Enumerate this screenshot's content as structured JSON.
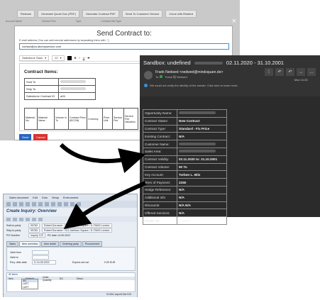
{
  "salesforce": {
    "bar_buttons": [
      "Reshare",
      "Generate Quote Doc (PDF)",
      "Generate Contract PDF",
      "Send To Customer Service",
      "Clone with Related"
    ],
    "sub_labels": [
      "Account Name",
      "Volume Prov",
      "Type",
      "Contract Info Type"
    ],
    "modal_title": "Send Contract to:",
    "email_hint": "E-mail address (You can add several addresses by separating them with ',')",
    "email_value": "contact@cs.abcmyservice.com",
    "font_select": "Salesforce Sans",
    "size_select": "12",
    "format_buttons": [
      "B",
      "I",
      "U",
      "S"
    ],
    "section_title": "Contract Items:",
    "items_table": [
      {
        "label": "Sold To",
        "value": ""
      },
      {
        "label": "Ship To",
        "value": ""
      },
      {
        "label": "Salesforce Contract ID",
        "value": "a26"
      }
    ],
    "item_columns": [
      "Material No.",
      "Material Name",
      "Volume in To",
      "Contract Price (€/CON)",
      "Currency",
      "Price Unit",
      "Service Fee",
      "Service Fee Valuation"
    ],
    "send_label": "Send",
    "cancel_label": "Cancel",
    "close_glyph": "×"
  },
  "outlook": {
    "subject_prefix": "Sandbox: undefined",
    "subject_dates": "02.11.2020 - 31.10.2001",
    "from": "Frank Nedwed <nedwed@mindsquare.de>",
    "to_label": "To:",
    "to_value": "Frank 现 Nedwed",
    "warning": "We could not verify the identity of the sender. Click here to learn more.",
    "time": "Mon 11:33",
    "action_glyphs": [
      "⁞",
      "↶",
      "↶",
      "→",
      "…"
    ],
    "rows": [
      {
        "key": "Opportunity Name:",
        "value": ""
      },
      {
        "key": "Contract Status:",
        "value": "New Contract"
      },
      {
        "key": "Contract Type:",
        "value": "Standard - Fix Price"
      },
      {
        "key": "Existing Contract:",
        "value": "N/A"
      },
      {
        "key": "Customer Name:",
        "value": ""
      },
      {
        "key": "Sales Area:",
        "value": ""
      },
      {
        "key": "Contract Validity:",
        "value": "02.11.2020 to: 31.10.2001"
      },
      {
        "key": "Contract Volume:",
        "value": "50 To"
      },
      {
        "key": "Key Account:",
        "value": "Torben L. Bils"
      },
      {
        "key": "Term of Payment:",
        "value": "Z260"
      },
      {
        "key": "Hedge Reference:",
        "value": "N/A"
      },
      {
        "key": "Additional Info",
        "value": "N/A"
      },
      {
        "key": "Discounts:",
        "value": "N/A  N/A"
      },
      {
        "key": "Offered Services:",
        "value": "N/A"
      },
      {
        "key": "Tender ID:",
        "value": "X73020"
      }
    ]
  },
  "sap": {
    "menu": [
      "Sales document",
      "Edit",
      "Goto",
      "Setup",
      "Environment"
    ],
    "title": "Create Inquiry: Overview",
    "rows": [
      {
        "label": "Sold-to party",
        "field1": "99783",
        "field2": "Robert Dorosner / 321 Atchison Square / D-75400 London"
      },
      {
        "label": "Ship-to party",
        "field1": "99783",
        "field2": "Robert Dorosner / 321 Atchison Square / D-75400 London"
      },
      {
        "label": "PO Number",
        "field1": "Inquiry 123",
        "field2": "PO date   14.05.2022"
      }
    ],
    "tabs": [
      "Sales",
      "Item overview",
      "Item detail",
      "Ordering party",
      "Procurement"
    ],
    "panel_rows": [
      {
        "label": "Valid from",
        "value": ""
      },
      {
        "label": "Valid to",
        "value": ""
      },
      {
        "label": "Req. deliv.date",
        "value": "D  14.05.2022"
      }
    ],
    "expect_label": "Expect.ord.val.",
    "expect_value": "0.00 EUR",
    "items_header": [
      "Item",
      "Material",
      "Order Quantity",
      "SU",
      "Descr."
    ],
    "items_title": "All Items",
    "dropdown": [
      "AN",
      "LAST",
      "LAST"
    ],
    "status": "M  MA1  sapsb10ab  INS"
  }
}
